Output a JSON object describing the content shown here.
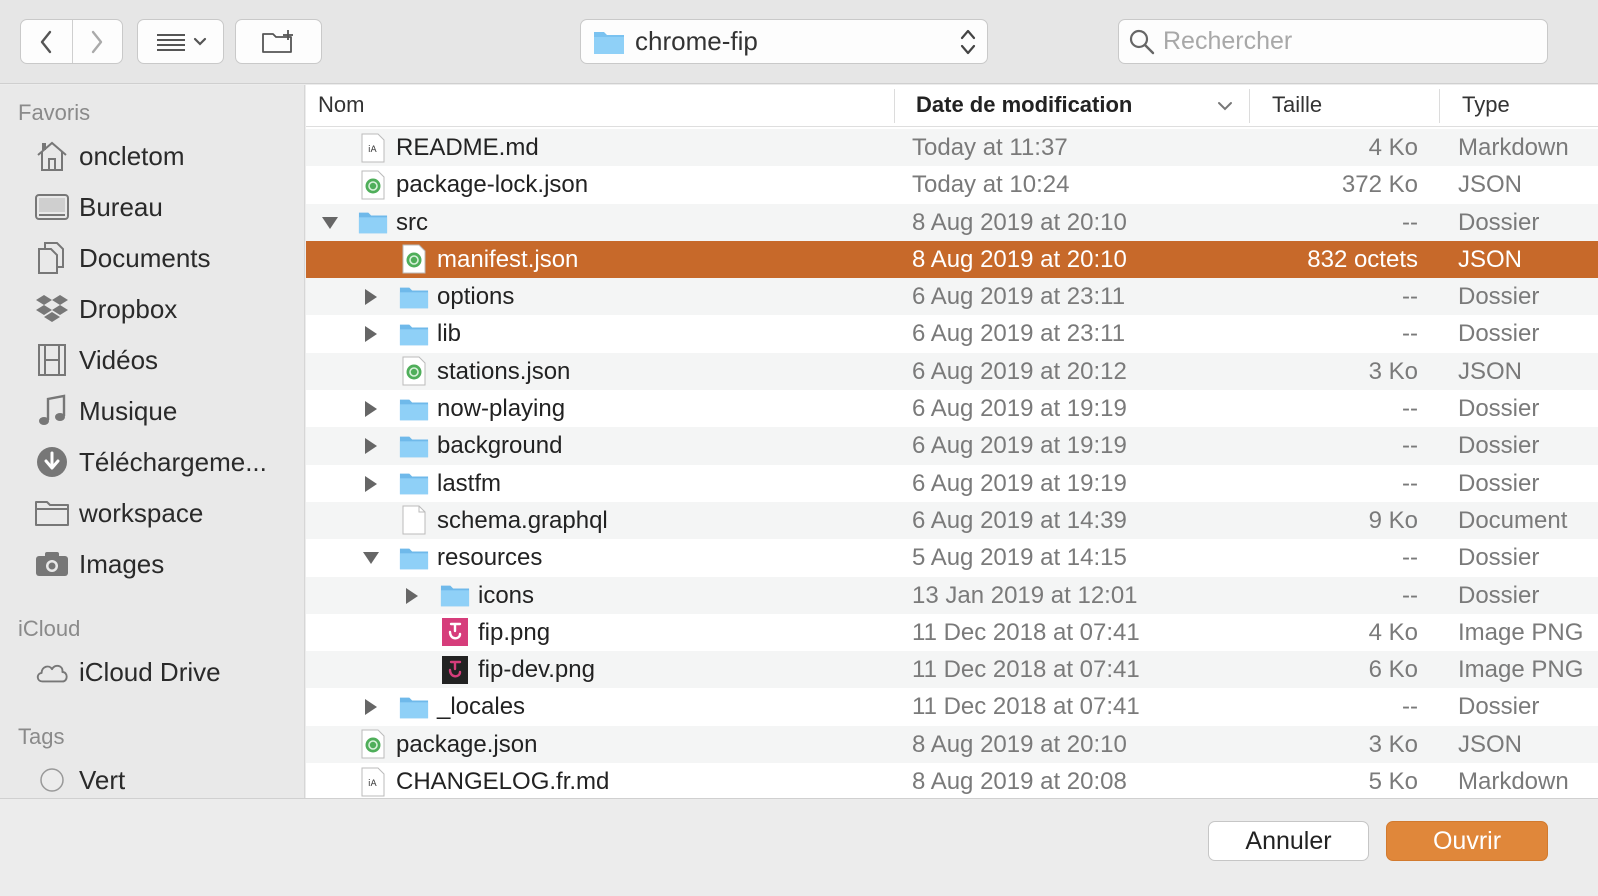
{
  "toolbar": {
    "back_icon": "chevron-left-icon",
    "forward_icon": "chevron-right-icon",
    "view_icon": "list-view-icon",
    "new_folder_icon": "new-folder-icon",
    "path": "chrome-fip",
    "search_placeholder": "Rechercher"
  },
  "sidebar": {
    "favorites_title": "Favoris",
    "favorites": [
      {
        "label": "oncletom",
        "icon": "home-icon"
      },
      {
        "label": "Bureau",
        "icon": "desktop-icon"
      },
      {
        "label": "Documents",
        "icon": "documents-icon"
      },
      {
        "label": "Dropbox",
        "icon": "dropbox-icon"
      },
      {
        "label": "Vidéos",
        "icon": "film-icon"
      },
      {
        "label": "Musique",
        "icon": "music-note-icon"
      },
      {
        "label": "Téléchargeme...",
        "icon": "download-icon"
      },
      {
        "label": "workspace",
        "icon": "folder-icon"
      },
      {
        "label": "Images",
        "icon": "camera-icon"
      }
    ],
    "icloud_title": "iCloud",
    "icloud": [
      {
        "label": "iCloud Drive",
        "icon": "cloud-icon"
      }
    ],
    "tags_title": "Tags",
    "tags": [
      {
        "label": "Vert",
        "icon": "tag-circle-icon"
      }
    ]
  },
  "columns": {
    "name": "Nom",
    "date": "Date de modification",
    "size": "Taille",
    "type": "Type"
  },
  "files": [
    {
      "name": "README.md",
      "date": "Today at 11:37",
      "size": "4 Ko",
      "type": "Markdown",
      "kind": "md",
      "level": 0,
      "disclosure": "none",
      "selected": false
    },
    {
      "name": "package-lock.json",
      "date": "Today at 10:24",
      "size": "372 Ko",
      "type": "JSON",
      "kind": "json",
      "level": 0,
      "disclosure": "none",
      "selected": false
    },
    {
      "name": "src",
      "date": "8 Aug 2019 at 20:10",
      "size": "--",
      "type": "Dossier",
      "kind": "folder",
      "level": 0,
      "disclosure": "open",
      "selected": false
    },
    {
      "name": "manifest.json",
      "date": "8 Aug 2019 at 20:10",
      "size": "832 octets",
      "type": "JSON",
      "kind": "json",
      "level": 1,
      "disclosure": "none",
      "selected": true
    },
    {
      "name": "options",
      "date": "6 Aug 2019 at 23:11",
      "size": "--",
      "type": "Dossier",
      "kind": "folder",
      "level": 1,
      "disclosure": "closed",
      "selected": false
    },
    {
      "name": "lib",
      "date": "6 Aug 2019 at 23:11",
      "size": "--",
      "type": "Dossier",
      "kind": "folder",
      "level": 1,
      "disclosure": "closed",
      "selected": false
    },
    {
      "name": "stations.json",
      "date": "6 Aug 2019 at 20:12",
      "size": "3 Ko",
      "type": "JSON",
      "kind": "json",
      "level": 1,
      "disclosure": "none",
      "selected": false
    },
    {
      "name": "now-playing",
      "date": "6 Aug 2019 at 19:19",
      "size": "--",
      "type": "Dossier",
      "kind": "folder",
      "level": 1,
      "disclosure": "closed",
      "selected": false
    },
    {
      "name": "background",
      "date": "6 Aug 2019 at 19:19",
      "size": "--",
      "type": "Dossier",
      "kind": "folder",
      "level": 1,
      "disclosure": "closed",
      "selected": false
    },
    {
      "name": "lastfm",
      "date": "6 Aug 2019 at 19:19",
      "size": "--",
      "type": "Dossier",
      "kind": "folder",
      "level": 1,
      "disclosure": "closed",
      "selected": false
    },
    {
      "name": "schema.graphql",
      "date": "6 Aug 2019 at 14:39",
      "size": "9 Ko",
      "type": "Document",
      "kind": "doc",
      "level": 1,
      "disclosure": "none",
      "selected": false
    },
    {
      "name": "resources",
      "date": "5 Aug 2019 at 14:15",
      "size": "--",
      "type": "Dossier",
      "kind": "folder",
      "level": 1,
      "disclosure": "open",
      "selected": false
    },
    {
      "name": "icons",
      "date": "13 Jan 2019 at 12:01",
      "size": "--",
      "type": "Dossier",
      "kind": "folder",
      "level": 2,
      "disclosure": "closed",
      "selected": false
    },
    {
      "name": "fip.png",
      "date": "11 Dec 2018 at 07:41",
      "size": "4 Ko",
      "type": "Image PNG",
      "kind": "png",
      "level": 2,
      "disclosure": "none",
      "selected": false
    },
    {
      "name": "fip-dev.png",
      "date": "11 Dec 2018 at 07:41",
      "size": "6 Ko",
      "type": "Image PNG",
      "kind": "png-dev",
      "level": 2,
      "disclosure": "none",
      "selected": false
    },
    {
      "name": "_locales",
      "date": "11 Dec 2018 at 07:41",
      "size": "--",
      "type": "Dossier",
      "kind": "folder",
      "level": 1,
      "disclosure": "closed",
      "selected": false
    },
    {
      "name": "package.json",
      "date": "8 Aug 2019 at 20:10",
      "size": "3 Ko",
      "type": "JSON",
      "kind": "json",
      "level": 0,
      "disclosure": "none",
      "selected": false
    },
    {
      "name": "CHANGELOG.fr.md",
      "date": "8 Aug 2019 at 20:08",
      "size": "5 Ko",
      "type": "Markdown",
      "kind": "md",
      "level": 0,
      "disclosure": "none",
      "selected": false
    }
  ],
  "footer": {
    "cancel_label": "Annuler",
    "open_label": "Ouvrir"
  },
  "colors": {
    "selection": "#c7692a",
    "open_button": "#e0873a",
    "folder": "#7ac2f0"
  }
}
